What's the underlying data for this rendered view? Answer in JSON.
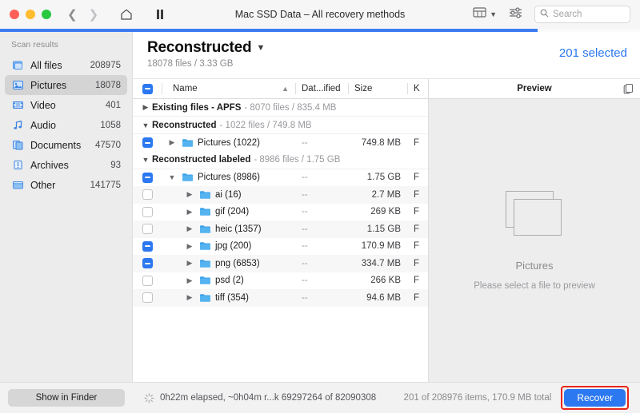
{
  "titlebar": {
    "title": "Mac SSD Data – All recovery methods",
    "back_icon": "chevron-left-icon",
    "forward_icon": "chevron-right-icon",
    "home_icon": "home-icon",
    "pause_icon": "pause-icon",
    "view_icon": "table-view-icon",
    "view_caret": "chevron-down-icon",
    "filter_icon": "sliders-icon",
    "search_placeholder": "Search",
    "search_value": "",
    "search_icon": "search-icon"
  },
  "progress": {
    "percent": 84,
    "color": "#3b7cf2"
  },
  "sidebar": {
    "heading": "Scan results",
    "items": [
      {
        "label": "All files",
        "count": "208975",
        "icon": "all-files-icon",
        "active": false
      },
      {
        "label": "Pictures",
        "count": "18078",
        "icon": "pictures-icon",
        "active": true
      },
      {
        "label": "Video",
        "count": "401",
        "icon": "video-icon",
        "active": false
      },
      {
        "label": "Audio",
        "count": "1058",
        "icon": "audio-icon",
        "active": false
      },
      {
        "label": "Documents",
        "count": "47570",
        "icon": "documents-icon",
        "active": false
      },
      {
        "label": "Archives",
        "count": "93",
        "icon": "archives-icon",
        "active": false
      },
      {
        "label": "Other",
        "count": "141775",
        "icon": "other-icon",
        "active": false
      }
    ],
    "show_in_finder": "Show in Finder"
  },
  "main_header": {
    "title": "Reconstructed",
    "caret": "chevron-down-icon",
    "subtitle": "18078 files / 3.33 GB",
    "selected": "201 selected",
    "selected_color": "#2b78f0"
  },
  "table": {
    "columns": {
      "name": "Name",
      "date": "Dat...ified",
      "size": "Size",
      "kind": "K",
      "sort_icon": "chevron-up-icon",
      "header_checkbox": "mixed"
    },
    "rows": [
      {
        "type": "group",
        "caret": "chevron-right-icon",
        "name": "Existing files - APFS",
        "meta": "- 8070 files / 835.4 MB"
      },
      {
        "type": "group",
        "caret": "chevron-down-icon",
        "name": "Reconstructed",
        "meta": "- 1022 files / 749.8 MB"
      },
      {
        "type": "file",
        "check": "mixed",
        "caret": "chevron-right-icon",
        "indent": 0,
        "label": "Pictures (1022)",
        "date": "--",
        "size": "749.8 MB",
        "kind": "F",
        "alt": false
      },
      {
        "type": "group",
        "caret": "chevron-down-icon",
        "name": "Reconstructed labeled",
        "meta": "- 8986 files / 1.75 GB"
      },
      {
        "type": "file",
        "check": "mixed",
        "caret": "chevron-down-icon",
        "indent": 0,
        "label": "Pictures (8986)",
        "date": "--",
        "size": "1.75 GB",
        "kind": "F",
        "alt": false
      },
      {
        "type": "file",
        "check": "off",
        "caret": "chevron-right-icon",
        "indent": 1,
        "label": "ai (16)",
        "date": "--",
        "size": "2.7 MB",
        "kind": "F",
        "alt": true
      },
      {
        "type": "file",
        "check": "off",
        "caret": "chevron-right-icon",
        "indent": 1,
        "label": "gif (204)",
        "date": "--",
        "size": "269 KB",
        "kind": "F",
        "alt": false
      },
      {
        "type": "file",
        "check": "off",
        "caret": "chevron-right-icon",
        "indent": 1,
        "label": "heic (1357)",
        "date": "--",
        "size": "1.15 GB",
        "kind": "F",
        "alt": true
      },
      {
        "type": "file",
        "check": "mixed",
        "caret": "chevron-right-icon",
        "indent": 1,
        "label": "jpg (200)",
        "date": "--",
        "size": "170.9 MB",
        "kind": "F",
        "alt": false
      },
      {
        "type": "file",
        "check": "mixed",
        "caret": "chevron-right-icon",
        "indent": 1,
        "label": "png (6853)",
        "date": "--",
        "size": "334.7 MB",
        "kind": "F",
        "alt": true
      },
      {
        "type": "file",
        "check": "off",
        "caret": "chevron-right-icon",
        "indent": 1,
        "label": "psd (2)",
        "date": "--",
        "size": "266 KB",
        "kind": "F",
        "alt": false
      },
      {
        "type": "file",
        "check": "off",
        "caret": "chevron-right-icon",
        "indent": 1,
        "label": "tiff (354)",
        "date": "--",
        "size": "94.6 MB",
        "kind": "F",
        "alt": true
      }
    ]
  },
  "preview": {
    "header": "Preview",
    "copy_icon": "duplicate-icon",
    "placeholder_icon": "stacked-images-icon",
    "title": "Pictures",
    "subtitle": "Please select a file to preview"
  },
  "statusbar": {
    "spinner_icon": "spinner-icon",
    "progress_text": "0h22m elapsed, ~0h04m r...k 69297264 of 82090308",
    "count_text": "201 of 208976 items, 170.9 MB total",
    "recover_label": "Recover",
    "recover_highlight_color": "#e8261c"
  }
}
